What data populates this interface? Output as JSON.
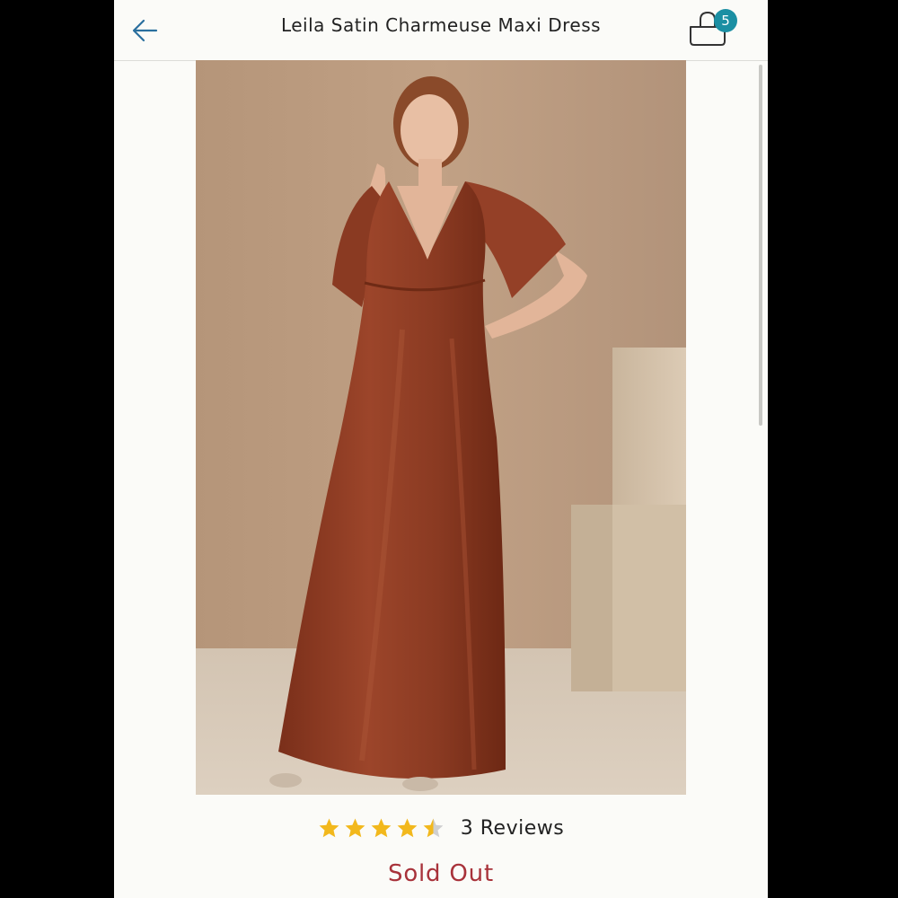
{
  "header": {
    "title": "Leila Satin Charmeuse Maxi Dress",
    "back_icon": "arrow-left-icon",
    "cart_icon": "shopping-bag-icon",
    "cart_count": "5"
  },
  "product": {
    "image_description": "model-wearing-rust-satin-maxi-dress",
    "rating": 4.5,
    "rating_max": 5,
    "reviews_label": "3 Reviews",
    "status": "Sold Out"
  },
  "colors": {
    "accent": "#1b8fa3",
    "star": "#f2b81c",
    "star_empty": "#cfcfcf",
    "sold_out": "#a8323a",
    "dress": "#8a3a22"
  }
}
